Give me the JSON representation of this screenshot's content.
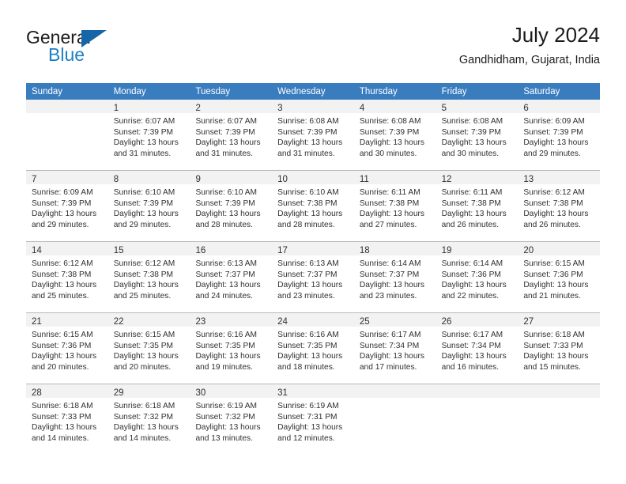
{
  "brand": {
    "name_part1": "General",
    "name_part2": "Blue"
  },
  "header": {
    "title": "July 2024",
    "subtitle": "Gandhidham, Gujarat, India"
  },
  "colors": {
    "header_blue": "#3a7dbf",
    "logo_blue": "#1f7fc4",
    "daynum_bg": "#f2f2f2",
    "row_divider": "#b9b9b9"
  },
  "weekdays": [
    "Sunday",
    "Monday",
    "Tuesday",
    "Wednesday",
    "Thursday",
    "Friday",
    "Saturday"
  ],
  "weeks": [
    [
      {
        "day": "",
        "sunrise": "",
        "sunset": "",
        "daylight_line1": "",
        "daylight_line2": ""
      },
      {
        "day": "1",
        "sunrise": "Sunrise: 6:07 AM",
        "sunset": "Sunset: 7:39 PM",
        "daylight_line1": "Daylight: 13 hours",
        "daylight_line2": "and 31 minutes."
      },
      {
        "day": "2",
        "sunrise": "Sunrise: 6:07 AM",
        "sunset": "Sunset: 7:39 PM",
        "daylight_line1": "Daylight: 13 hours",
        "daylight_line2": "and 31 minutes."
      },
      {
        "day": "3",
        "sunrise": "Sunrise: 6:08 AM",
        "sunset": "Sunset: 7:39 PM",
        "daylight_line1": "Daylight: 13 hours",
        "daylight_line2": "and 31 minutes."
      },
      {
        "day": "4",
        "sunrise": "Sunrise: 6:08 AM",
        "sunset": "Sunset: 7:39 PM",
        "daylight_line1": "Daylight: 13 hours",
        "daylight_line2": "and 30 minutes."
      },
      {
        "day": "5",
        "sunrise": "Sunrise: 6:08 AM",
        "sunset": "Sunset: 7:39 PM",
        "daylight_line1": "Daylight: 13 hours",
        "daylight_line2": "and 30 minutes."
      },
      {
        "day": "6",
        "sunrise": "Sunrise: 6:09 AM",
        "sunset": "Sunset: 7:39 PM",
        "daylight_line1": "Daylight: 13 hours",
        "daylight_line2": "and 29 minutes."
      }
    ],
    [
      {
        "day": "7",
        "sunrise": "Sunrise: 6:09 AM",
        "sunset": "Sunset: 7:39 PM",
        "daylight_line1": "Daylight: 13 hours",
        "daylight_line2": "and 29 minutes."
      },
      {
        "day": "8",
        "sunrise": "Sunrise: 6:10 AM",
        "sunset": "Sunset: 7:39 PM",
        "daylight_line1": "Daylight: 13 hours",
        "daylight_line2": "and 29 minutes."
      },
      {
        "day": "9",
        "sunrise": "Sunrise: 6:10 AM",
        "sunset": "Sunset: 7:39 PM",
        "daylight_line1": "Daylight: 13 hours",
        "daylight_line2": "and 28 minutes."
      },
      {
        "day": "10",
        "sunrise": "Sunrise: 6:10 AM",
        "sunset": "Sunset: 7:38 PM",
        "daylight_line1": "Daylight: 13 hours",
        "daylight_line2": "and 28 minutes."
      },
      {
        "day": "11",
        "sunrise": "Sunrise: 6:11 AM",
        "sunset": "Sunset: 7:38 PM",
        "daylight_line1": "Daylight: 13 hours",
        "daylight_line2": "and 27 minutes."
      },
      {
        "day": "12",
        "sunrise": "Sunrise: 6:11 AM",
        "sunset": "Sunset: 7:38 PM",
        "daylight_line1": "Daylight: 13 hours",
        "daylight_line2": "and 26 minutes."
      },
      {
        "day": "13",
        "sunrise": "Sunrise: 6:12 AM",
        "sunset": "Sunset: 7:38 PM",
        "daylight_line1": "Daylight: 13 hours",
        "daylight_line2": "and 26 minutes."
      }
    ],
    [
      {
        "day": "14",
        "sunrise": "Sunrise: 6:12 AM",
        "sunset": "Sunset: 7:38 PM",
        "daylight_line1": "Daylight: 13 hours",
        "daylight_line2": "and 25 minutes."
      },
      {
        "day": "15",
        "sunrise": "Sunrise: 6:12 AM",
        "sunset": "Sunset: 7:38 PM",
        "daylight_line1": "Daylight: 13 hours",
        "daylight_line2": "and 25 minutes."
      },
      {
        "day": "16",
        "sunrise": "Sunrise: 6:13 AM",
        "sunset": "Sunset: 7:37 PM",
        "daylight_line1": "Daylight: 13 hours",
        "daylight_line2": "and 24 minutes."
      },
      {
        "day": "17",
        "sunrise": "Sunrise: 6:13 AM",
        "sunset": "Sunset: 7:37 PM",
        "daylight_line1": "Daylight: 13 hours",
        "daylight_line2": "and 23 minutes."
      },
      {
        "day": "18",
        "sunrise": "Sunrise: 6:14 AM",
        "sunset": "Sunset: 7:37 PM",
        "daylight_line1": "Daylight: 13 hours",
        "daylight_line2": "and 23 minutes."
      },
      {
        "day": "19",
        "sunrise": "Sunrise: 6:14 AM",
        "sunset": "Sunset: 7:36 PM",
        "daylight_line1": "Daylight: 13 hours",
        "daylight_line2": "and 22 minutes."
      },
      {
        "day": "20",
        "sunrise": "Sunrise: 6:15 AM",
        "sunset": "Sunset: 7:36 PM",
        "daylight_line1": "Daylight: 13 hours",
        "daylight_line2": "and 21 minutes."
      }
    ],
    [
      {
        "day": "21",
        "sunrise": "Sunrise: 6:15 AM",
        "sunset": "Sunset: 7:36 PM",
        "daylight_line1": "Daylight: 13 hours",
        "daylight_line2": "and 20 minutes."
      },
      {
        "day": "22",
        "sunrise": "Sunrise: 6:15 AM",
        "sunset": "Sunset: 7:35 PM",
        "daylight_line1": "Daylight: 13 hours",
        "daylight_line2": "and 20 minutes."
      },
      {
        "day": "23",
        "sunrise": "Sunrise: 6:16 AM",
        "sunset": "Sunset: 7:35 PM",
        "daylight_line1": "Daylight: 13 hours",
        "daylight_line2": "and 19 minutes."
      },
      {
        "day": "24",
        "sunrise": "Sunrise: 6:16 AM",
        "sunset": "Sunset: 7:35 PM",
        "daylight_line1": "Daylight: 13 hours",
        "daylight_line2": "and 18 minutes."
      },
      {
        "day": "25",
        "sunrise": "Sunrise: 6:17 AM",
        "sunset": "Sunset: 7:34 PM",
        "daylight_line1": "Daylight: 13 hours",
        "daylight_line2": "and 17 minutes."
      },
      {
        "day": "26",
        "sunrise": "Sunrise: 6:17 AM",
        "sunset": "Sunset: 7:34 PM",
        "daylight_line1": "Daylight: 13 hours",
        "daylight_line2": "and 16 minutes."
      },
      {
        "day": "27",
        "sunrise": "Sunrise: 6:18 AM",
        "sunset": "Sunset: 7:33 PM",
        "daylight_line1": "Daylight: 13 hours",
        "daylight_line2": "and 15 minutes."
      }
    ],
    [
      {
        "day": "28",
        "sunrise": "Sunrise: 6:18 AM",
        "sunset": "Sunset: 7:33 PM",
        "daylight_line1": "Daylight: 13 hours",
        "daylight_line2": "and 14 minutes."
      },
      {
        "day": "29",
        "sunrise": "Sunrise: 6:18 AM",
        "sunset": "Sunset: 7:32 PM",
        "daylight_line1": "Daylight: 13 hours",
        "daylight_line2": "and 14 minutes."
      },
      {
        "day": "30",
        "sunrise": "Sunrise: 6:19 AM",
        "sunset": "Sunset: 7:32 PM",
        "daylight_line1": "Daylight: 13 hours",
        "daylight_line2": "and 13 minutes."
      },
      {
        "day": "31",
        "sunrise": "Sunrise: 6:19 AM",
        "sunset": "Sunset: 7:31 PM",
        "daylight_line1": "Daylight: 13 hours",
        "daylight_line2": "and 12 minutes."
      },
      {
        "day": "",
        "sunrise": "",
        "sunset": "",
        "daylight_line1": "",
        "daylight_line2": ""
      },
      {
        "day": "",
        "sunrise": "",
        "sunset": "",
        "daylight_line1": "",
        "daylight_line2": ""
      },
      {
        "day": "",
        "sunrise": "",
        "sunset": "",
        "daylight_line1": "",
        "daylight_line2": ""
      }
    ]
  ]
}
